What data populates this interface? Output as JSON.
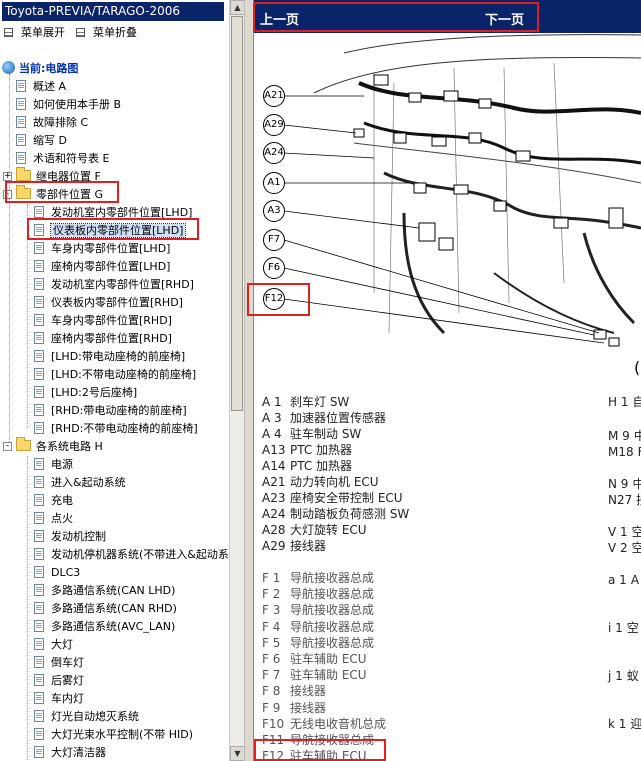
{
  "app": {
    "title": "Toyota-PREVIA/TARAGO-2006"
  },
  "toolbar": {
    "expand_label": "菜单展开",
    "collapse_label": "菜单折叠"
  },
  "tree": {
    "root_label": "当前:电路图",
    "items": [
      "概述 A",
      "如何使用本手册 B",
      "故障排除 C",
      "缩写 D",
      "术语和符号表 E",
      "继电器位置 F"
    ],
    "folder_parts": "零部件位置 G",
    "parts_children": [
      "发动机室内零部件位置[LHD]",
      "仪表板内零部件位置[LHD]",
      "车身内零部件位置[LHD]",
      "座椅内零部件位置[LHD]",
      "发动机室内零部件位置[RHD]",
      "仪表板内零部件位置[RHD]",
      "车身内零部件位置[RHD]",
      "座椅内零部件位置[RHD]",
      "[LHD:带电动座椅的前座椅]",
      "[LHD:不带电动座椅的前座椅]",
      "[LHD:2号后座椅]",
      "[RHD:带电动座椅的前座椅]",
      "[RHD:不带电动座椅的前座椅]"
    ],
    "folder_systems": "各系统电路 H",
    "system_children": [
      "电源",
      "进入&起动系统",
      "充电",
      "点火",
      "发动机控制",
      "发动机停机器系统(不带进入&起动系",
      "DLC3",
      "多路通信系统(CAN LHD)",
      "多路通信系统(CAN RHD)",
      "多路通信系统(AVC_LAN)",
      "大灯",
      "倒车灯",
      "后雾灯",
      "车内灯",
      "灯光自动熄灭系统",
      "大灯光束水平控制(不带 HID)",
      "大灯清洁器"
    ]
  },
  "nav": {
    "prev_label": "上一页",
    "next_label": "下一页"
  },
  "diagram": {
    "callouts": [
      "A21",
      "A29",
      "A24",
      "A1",
      "A3",
      "F7",
      "F6",
      "F12"
    ],
    "cropped_marker": "("
  },
  "legend_left_a": [
    {
      "code": "A 1",
      "name": "刹车灯 SW"
    },
    {
      "code": "A 3",
      "name": "加速器位置传感器"
    },
    {
      "code": "A 4",
      "name": "驻车制动 SW"
    },
    {
      "code": "A13",
      "name": "PTC 加热器"
    },
    {
      "code": "A14",
      "name": "PTC 加热器"
    },
    {
      "code": "A21",
      "name": "动力转向机 ECU"
    },
    {
      "code": "A23",
      "name": "座椅安全带控制 ECU"
    },
    {
      "code": "A24",
      "name": "制动踏板负荷感测 SW"
    },
    {
      "code": "A28",
      "name": "大灯旋转 ECU"
    },
    {
      "code": "A29",
      "name": "接线器"
    }
  ],
  "legend_left_f": [
    {
      "code": "F 1",
      "name": "导航接收器总成"
    },
    {
      "code": "F 2",
      "name": "导航接收器总成"
    },
    {
      "code": "F 3",
      "name": "导航接收器总成"
    },
    {
      "code": "F 4",
      "name": "导航接收器总成"
    },
    {
      "code": "F 5",
      "name": "导航接收器总成"
    },
    {
      "code": "F 6",
      "name": "驻车辅助 ECU"
    },
    {
      "code": "F 7",
      "name": "驻车辅助 ECU"
    },
    {
      "code": "F 8",
      "name": "接线器"
    },
    {
      "code": "F 9",
      "name": "接线器"
    },
    {
      "code": "F10",
      "name": "无线电收音机总成"
    },
    {
      "code": "F11",
      "name": "导航接收器总成"
    },
    {
      "code": "F12",
      "name": "驻车辅助 ECU"
    }
  ],
  "legend_right": [
    {
      "code": "H 1",
      "name": "自"
    },
    {
      "code": "M 9",
      "name": "中"
    },
    {
      "code": "M18",
      "name": "F"
    },
    {
      "code": "N 9",
      "name": "中"
    },
    {
      "code": "N27",
      "name": "接"
    },
    {
      "code": "V 1",
      "name": "空"
    },
    {
      "code": "V 2",
      "name": "空"
    },
    {
      "code": "a 1",
      "name": "A"
    },
    {
      "code": "",
      "name": "A"
    },
    {
      "code": "i 1",
      "name": "空"
    },
    {
      "code": "",
      "name": "蚁"
    },
    {
      "code": "j 1",
      "name": "蚁"
    },
    {
      "code": "",
      "name": "方"
    },
    {
      "code": "k 1",
      "name": "迎"
    },
    {
      "code": "",
      "name": "蚁"
    }
  ],
  "colors": {
    "title_bar": "#0a246a",
    "highlight": "#e02020",
    "selection": "#cfe0f5"
  }
}
